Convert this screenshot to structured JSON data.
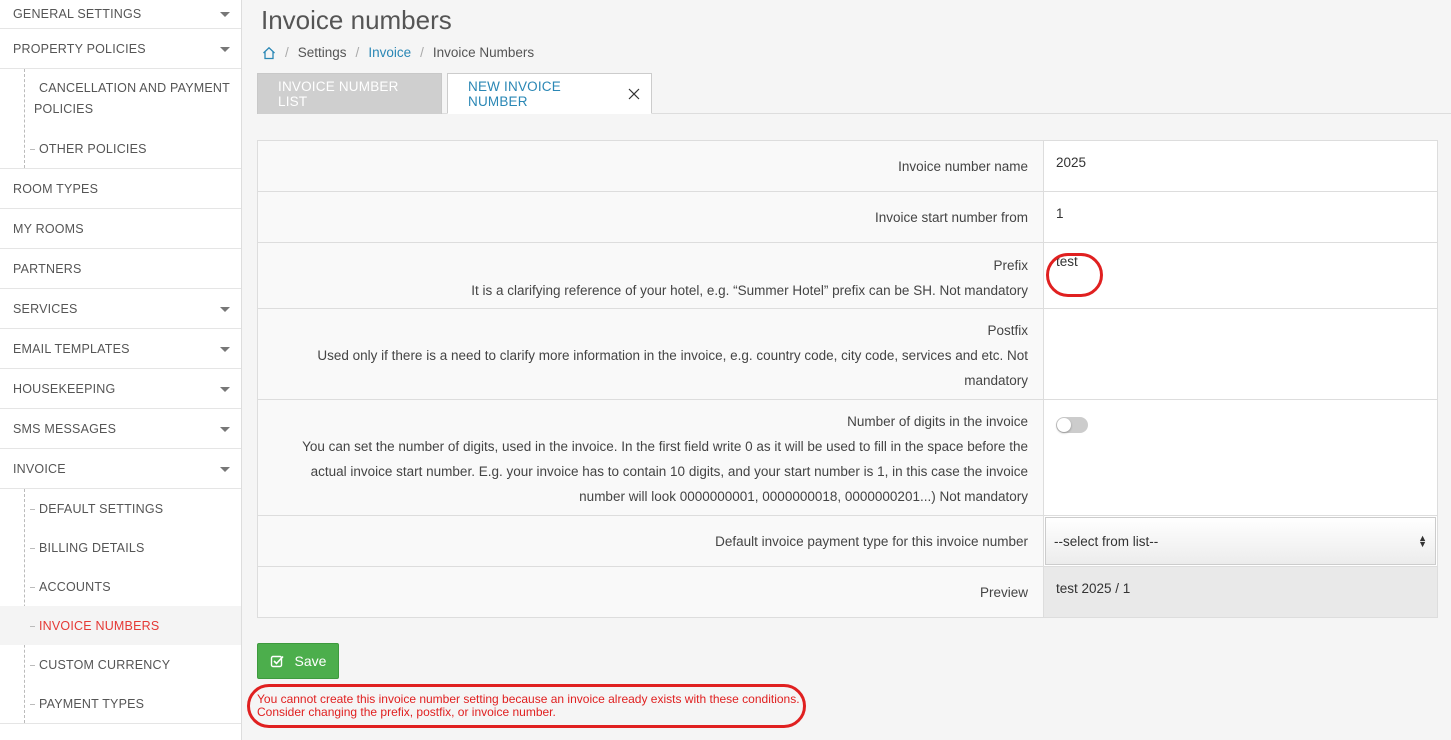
{
  "sidebar": {
    "general_settings": "GENERAL SETTINGS",
    "property_policies": "PROPERTY POLICIES",
    "cancellation": "CANCELLATION AND PAYMENT POLICIES",
    "other_policies": "OTHER POLICIES",
    "room_types": "ROOM TYPES",
    "my_rooms": "MY ROOMS",
    "partners": "PARTNERS",
    "services": "SERVICES",
    "email_templates": "EMAIL TEMPLATES",
    "housekeeping": "HOUSEKEEPING",
    "sms_messages": "SMS MESSAGES",
    "invoice": "INVOICE",
    "default_settings": "DEFAULT SETTINGS",
    "billing_details": "BILLING DETAILS",
    "accounts": "ACCOUNTS",
    "invoice_numbers": "INVOICE NUMBERS",
    "custom_currency": "CUSTOM CURRENCY",
    "payment_types": "PAYMENT TYPES"
  },
  "header": {
    "title": "Invoice numbers"
  },
  "breadcrumb": {
    "settings": "Settings",
    "invoice": "Invoice",
    "current": "Invoice Numbers",
    "separator": "/"
  },
  "tabs": {
    "list": "INVOICE NUMBER LIST",
    "new": "NEW INVOICE NUMBER"
  },
  "form": {
    "name_label": "Invoice number name",
    "name_value": "2025",
    "start_label": "Invoice start number from",
    "start_value": "1",
    "prefix_label": "Prefix",
    "prefix_desc": "It is a clarifying reference of your hotel, e.g. “Summer Hotel” prefix can be SH. Not mandatory",
    "prefix_value": "test",
    "postfix_label": "Postfix",
    "postfix_desc": "Used only if there is a need to clarify more information in the invoice, e.g. country code, city code, services and etc. Not mandatory",
    "postfix_value": "",
    "digits_label": "Number of digits in the invoice",
    "digits_desc": "You can set the number of digits, used in the invoice. In the first field write 0 as it will be used to fill in the space before the actual invoice start number. E.g. your invoice has to contain 10 digits, and your start number is 1, in this case the invoice number will look 0000000001, 0000000018, 0000000201...) Not mandatory",
    "payment_label": "Default invoice payment type for this invoice number",
    "payment_value": "--select from list--",
    "preview_label": "Preview",
    "preview_value": "test 2025 / 1"
  },
  "actions": {
    "save": "Save"
  },
  "error": {
    "message": "You cannot create this invoice number setting because an invoice already exists with these conditions. Consider changing the prefix, postfix, or invoice number."
  },
  "colors": {
    "accent": "#2a87b5",
    "active_nav": "#e53935",
    "save": "#4cae4c",
    "error": "#e02020"
  },
  "icons": {
    "home": "home-icon",
    "close": "close-icon",
    "check": "check-icon",
    "caret": "chevron-down-icon"
  }
}
